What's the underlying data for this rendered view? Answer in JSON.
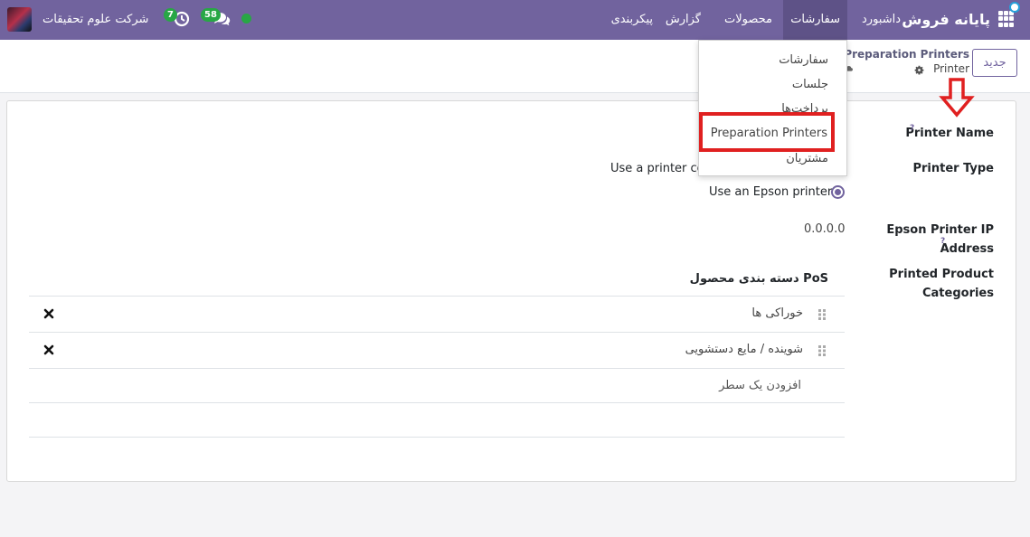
{
  "navbar": {
    "brand": "پایانه فروش",
    "menus": {
      "dashboard": "داشبورد",
      "orders": "سفارشات",
      "products": "محصولات",
      "report": "گزارش",
      "config": "پیکربندی"
    },
    "chat_count": "58",
    "activity_count": "7",
    "company": "شرکت علوم تحقیقات",
    "colors": {
      "primary": "#71639e",
      "badge": "#28a745",
      "highlight": "#e02020"
    }
  },
  "control": {
    "new_button": "جدید",
    "breadcrumb_parent": "Preparation Printers",
    "breadcrumb_current": "Printer"
  },
  "form": {
    "printer_name_label": "Printer Name",
    "help_mark": "?",
    "printer_type_label": "Printer Type",
    "printer_type_option1": "Use a printer co",
    "printer_type_option2": "Use an Epson printer",
    "ip_label": "Epson Printer IP Address",
    "ip_value": "0.0.0.0",
    "categories_label": "Printed Product Categories"
  },
  "table": {
    "header": "دسته بندی محصول PoS",
    "rows": [
      {
        "name": "خوراکی ها"
      },
      {
        "name": "شوینده / مایع دستشویی"
      }
    ],
    "add_line": "افزودن یک سطر"
  },
  "dropdown": {
    "items": [
      "سفارشات",
      "جلسات",
      "پرداخت‌ها",
      "Preparation Printers",
      "مشتریان"
    ]
  }
}
